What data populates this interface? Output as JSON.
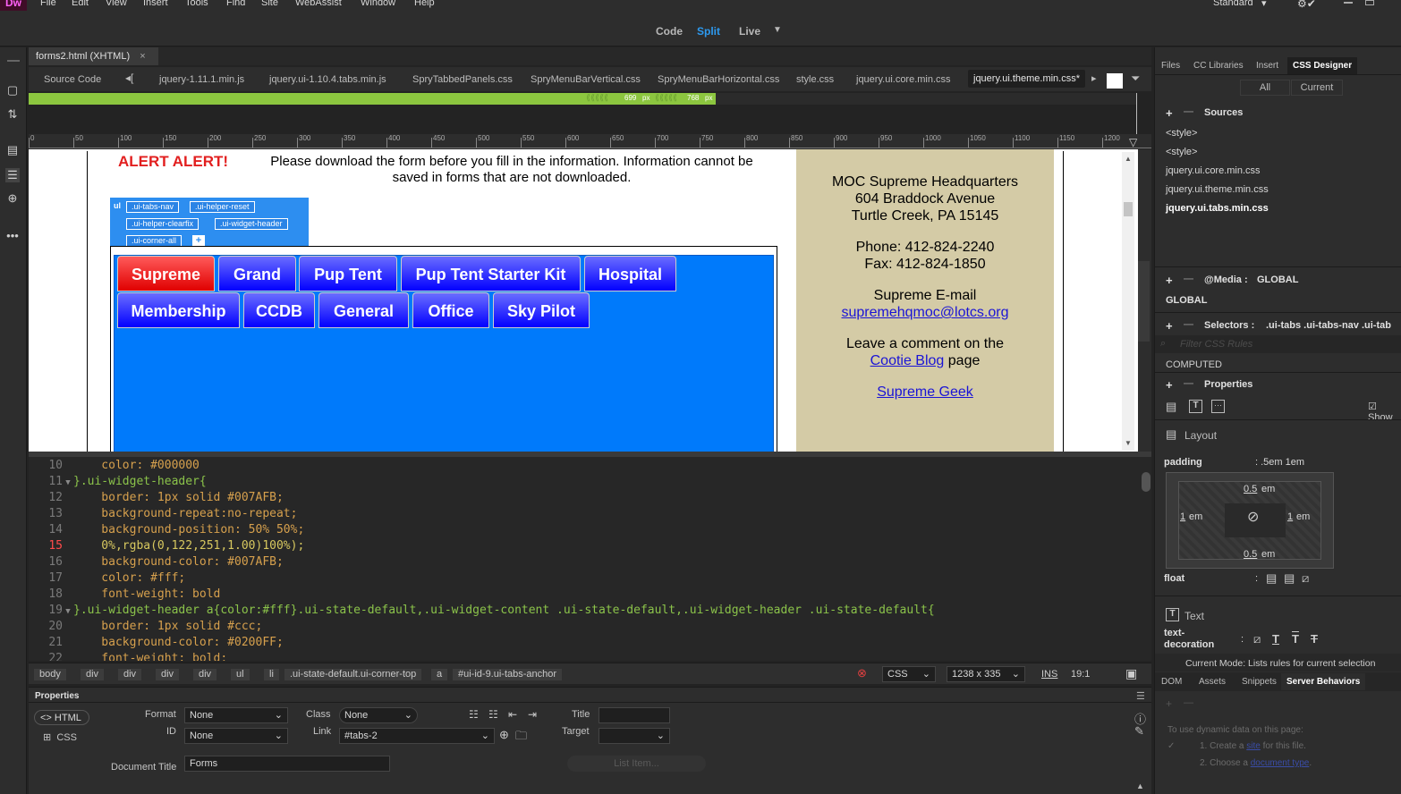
{
  "app": {
    "logo": "Dw",
    "menu": [
      "File",
      "Edit",
      "View",
      "Insert",
      "Tools",
      "Find",
      "Site",
      "WebAssist",
      "Window",
      "Help"
    ],
    "workspace": "Standard",
    "view_buttons": {
      "code": "Code",
      "split": "Split",
      "live": "Live"
    }
  },
  "document": {
    "tab_title": "forms2.html (XHTML)",
    "source_label": "Source Code",
    "related_files": [
      "jquery-1.11.1.min.js",
      "jquery.ui-1.10.4.tabs.min.js",
      "SpryTabbedPanels.css",
      "SpryMenuBarVertical.css",
      "SpryMenuBarHorizontal.css",
      "style.css",
      "jquery.ui.core.min.css",
      "jquery.ui.theme.min.css*"
    ],
    "media_query": {
      "a": "699",
      "a_unit": "px",
      "b": "768",
      "b_unit": "px"
    },
    "ruler": [
      "0",
      "50",
      "100",
      "150",
      "200",
      "250",
      "300",
      "350",
      "400",
      "450",
      "500",
      "550",
      "600",
      "650",
      "700",
      "750",
      "800",
      "850",
      "900",
      "950",
      "1000",
      "1050",
      "1100",
      "1150",
      "1200"
    ]
  },
  "live": {
    "alert_bold": "ALERT ALERT!",
    "alert_text": "Please download the form before you fill in the information. Information cannot be saved in forms that are not downloaded.",
    "hud": {
      "element": "ul",
      "classes": [
        ".ui-tabs-nav",
        ".ui-helper-reset",
        ".ui-helper-clearfix",
        ".ui-widget-header",
        ".ui-corner-all"
      ],
      "add": "+"
    },
    "tabs_row1": [
      "Supreme",
      "Grand",
      "Pup Tent",
      "Pup Tent Starter Kit",
      "Hospital"
    ],
    "tabs_row2": [
      "Membership",
      "CCDB",
      "General",
      "Office",
      "Sky Pilot"
    ],
    "info": {
      "line1": "MOC Supreme Headquarters",
      "line2": "604 Braddock Avenue",
      "line3": "Turtle Creek, PA 15145",
      "phone": "Phone: 412-824-2240",
      "fax": "Fax: 412-824-1850",
      "email_label": "Supreme E-mail",
      "email": "supremehqmoc@lotcs.org",
      "comment_pre": "Leave a comment on the",
      "comment_link": "Cootie Blog",
      "comment_post": " page",
      "geek": "Supreme Geek"
    }
  },
  "code_lines": [
    {
      "n": "10",
      "t": "    color: #000000"
    },
    {
      "n": "11",
      "t": "}.ui-widget-header{"
    },
    {
      "n": "12",
      "t": "    border: 1px solid #007AFB;"
    },
    {
      "n": "13",
      "t": "    background-repeat:no-repeat;"
    },
    {
      "n": "14",
      "t": "    background-position: 50% 50%;"
    },
    {
      "n": "15",
      "t": "    0%,rgba(0,122,251,1.00)100%);"
    },
    {
      "n": "16",
      "t": "    background-color: #007AFB;"
    },
    {
      "n": "17",
      "t": "    color: #fff;"
    },
    {
      "n": "18",
      "t": "    font-weight: bold"
    },
    {
      "n": "19",
      "t": "}.ui-widget-header a{color:#fff}.ui-state-default,.ui-widget-content .ui-state-default,.ui-widget-header .ui-state-default{"
    },
    {
      "n": "20",
      "t": "    border: 1px solid #ccc;"
    },
    {
      "n": "21",
      "t": "    background-color: #0200FF;"
    },
    {
      "n": "22",
      "t": "    font-weight: bold;"
    }
  ],
  "tagbar": {
    "tags": [
      "body",
      "div",
      "div",
      "div",
      "div",
      "ul",
      "li",
      ".ui-state-default.ui-corner-top",
      "a",
      "#ui-id-9.ui-tabs-anchor"
    ],
    "lang": "CSS",
    "size": "1238 x 335",
    "ins": "INS",
    "pos": "19:1"
  },
  "properties": {
    "title": "Properties",
    "html_btn": "HTML",
    "css_btn": "CSS",
    "format_label": "Format",
    "format_value": "None",
    "id_label": "ID",
    "id_value": "None",
    "class_label": "Class",
    "class_value": "None",
    "link_label": "Link",
    "link_value": "#tabs-2",
    "title_label": "Title",
    "target_label": "Target",
    "doc_title_label": "Document Title",
    "doc_title_value": "Forms",
    "list_item": "List Item..."
  },
  "right": {
    "tabs": [
      "Files",
      "CC Libraries",
      "Insert",
      "CSS Designer"
    ],
    "toggle": [
      "All",
      "Current"
    ],
    "sources_label": "Sources",
    "sources": [
      "<style>",
      "<style>",
      "jquery.ui.core.min.css",
      "jquery.ui.theme.min.css",
      "jquery.ui.tabs.min.css"
    ],
    "media_label": "@Media :",
    "media_value": "GLOBAL",
    "global": "GLOBAL",
    "selectors_label": "Selectors :",
    "selectors_value": ".ui-tabs .ui-tabs-nav .ui-tab",
    "filter_placeholder": "Filter CSS Rules",
    "computed": "COMPUTED",
    "properties_label": "Properties",
    "show_set": "Show",
    "layout_label": "Layout",
    "padding_label": "padding",
    "padding_value": ".5em 1em",
    "pad_top": "0.5",
    "pad_bottom": "0.5",
    "pad_left": "1",
    "pad_right": "1",
    "unit": "em",
    "float_label": "float",
    "text_label": "Text",
    "text_decoration_label": "text-decoration",
    "mode_text": "Current Mode: Lists rules for current selection",
    "bottom_tabs": [
      "DOM",
      "Assets",
      "Snippets",
      "Server Behaviors"
    ],
    "sb_intro": "To use dynamic data on this page:",
    "sb_step1_pre": "1.  Create a",
    "sb_step1_link": "site",
    "sb_step1_post": "for this file.",
    "sb_step2_pre": "2.  Choose a",
    "sb_step2_link": "document type"
  },
  "colors": {
    "accent": "#2d9af0",
    "tab_blue": "#0200FF",
    "tab_red": "#e00000",
    "panel_bg": "#007AFB",
    "info_bg": "#d4cba6"
  }
}
